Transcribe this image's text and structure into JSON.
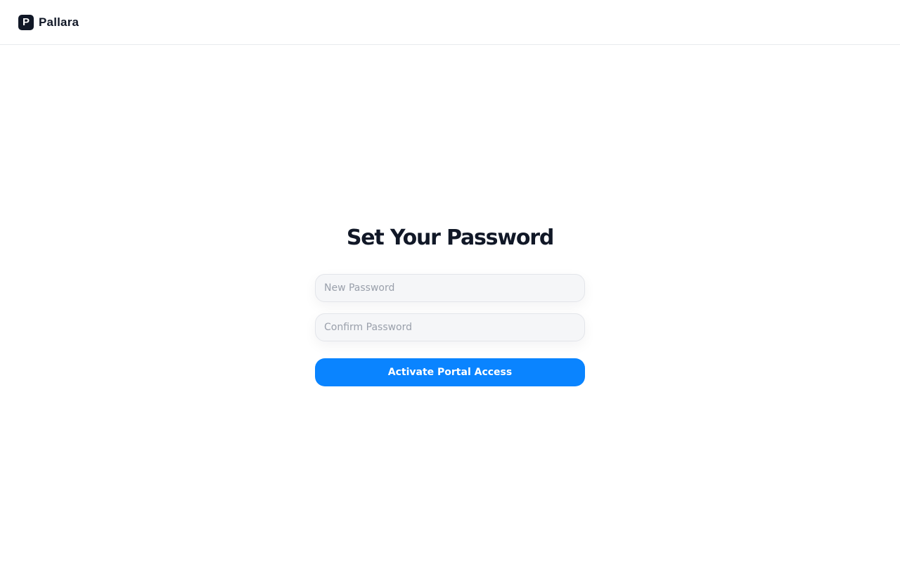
{
  "header": {
    "logo_letter": "P",
    "brand_name": "Pallara"
  },
  "form": {
    "title": "Set Your Password",
    "new_password": {
      "value": "",
      "placeholder": "New Password"
    },
    "confirm_password": {
      "value": "",
      "placeholder": "Confirm Password"
    },
    "submit_label": "Activate Portal Access"
  },
  "colors": {
    "brand": "#111827",
    "accent": "#0a84ff",
    "input_bg": "#f5f6f8"
  }
}
